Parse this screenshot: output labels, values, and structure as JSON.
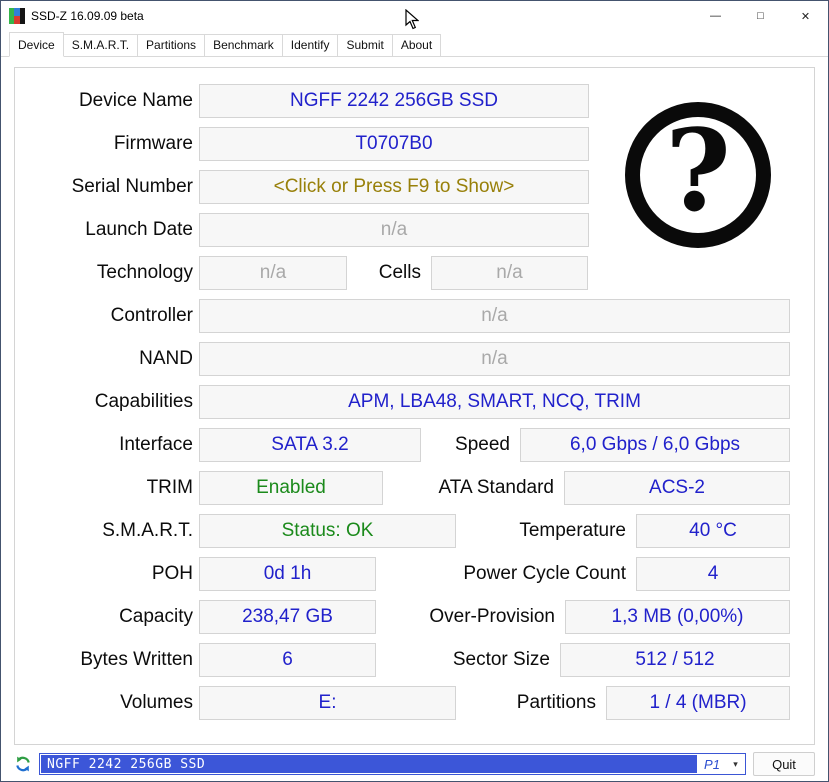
{
  "window": {
    "title": "SSD-Z 16.09.09 beta",
    "minimize_icon": "—",
    "maximize_icon": "□",
    "close_icon": "✕"
  },
  "tabs": [
    {
      "label": "Device",
      "active": true
    },
    {
      "label": "S.M.A.R.T.",
      "active": false
    },
    {
      "label": "Partitions",
      "active": false
    },
    {
      "label": "Benchmark",
      "active": false
    },
    {
      "label": "Identify",
      "active": false
    },
    {
      "label": "Submit",
      "active": false
    },
    {
      "label": "About",
      "active": false
    }
  ],
  "fields": {
    "device_name": {
      "label": "Device Name",
      "value": "NGFF 2242 256GB SSD"
    },
    "firmware": {
      "label": "Firmware",
      "value": "T0707B0"
    },
    "serial_number": {
      "label": "Serial Number",
      "value": "<Click or Press F9 to Show>"
    },
    "launch_date": {
      "label": "Launch Date",
      "value": "n/a"
    },
    "technology": {
      "label": "Technology",
      "value": "n/a"
    },
    "cells": {
      "label": "Cells",
      "value": "n/a"
    },
    "controller": {
      "label": "Controller",
      "value": "n/a"
    },
    "nand": {
      "label": "NAND",
      "value": "n/a"
    },
    "capabilities": {
      "label": "Capabilities",
      "value": "APM, LBA48, SMART, NCQ, TRIM"
    },
    "interface": {
      "label": "Interface",
      "value": "SATA 3.2"
    },
    "speed": {
      "label": "Speed",
      "value": "6,0 Gbps / 6,0 Gbps"
    },
    "trim": {
      "label": "TRIM",
      "value": "Enabled"
    },
    "ata_standard": {
      "label": "ATA Standard",
      "value": "ACS-2"
    },
    "smart": {
      "label": "S.M.A.R.T.",
      "value": "Status: OK"
    },
    "temperature": {
      "label": "Temperature",
      "value": "40 °C"
    },
    "poh": {
      "label": "POH",
      "value": "0d 1h"
    },
    "power_cycle_count": {
      "label": "Power Cycle Count",
      "value": "4"
    },
    "capacity": {
      "label": "Capacity",
      "value": "238,47 GB"
    },
    "over_provision": {
      "label": "Over-Provision",
      "value": "1,3 MB (0,00%)"
    },
    "bytes_written": {
      "label": "Bytes Written",
      "value": "6"
    },
    "sector_size": {
      "label": "Sector Size",
      "value": "512 / 512"
    },
    "volumes": {
      "label": "Volumes",
      "value": "E:"
    },
    "partitions": {
      "label": "Partitions",
      "value": "1 / 4 (MBR)"
    }
  },
  "device_image": {
    "glyph": "?"
  },
  "footer": {
    "drive_selector": "NGFF 2242 256GB SSD",
    "partition_indicator": "P1",
    "dropdown_icon": "▾",
    "quit_label": "Quit"
  },
  "colors": {
    "value_blue": "#2121cb",
    "status_green": "#1b8a1b",
    "serial_olive": "#98800a",
    "na_gray": "#a9a9a9",
    "combo_blue": "#3c56d8"
  }
}
